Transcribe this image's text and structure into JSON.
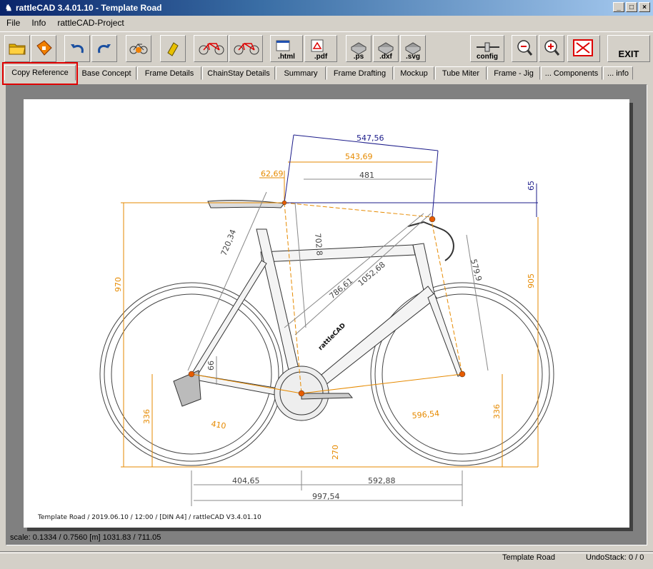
{
  "window": {
    "title": "rattleCAD  3.4.01.10 - Template Road",
    "buttons": {
      "minimize": "_",
      "maximize": "□",
      "close": "×"
    }
  },
  "menu": {
    "items": [
      {
        "label": "File"
      },
      {
        "label": "Info"
      },
      {
        "label": "rattleCAD-Project"
      }
    ]
  },
  "toolbar": {
    "buttons": [
      {
        "name": "open-folder",
        "label": "",
        "icon": "folder-icon"
      },
      {
        "name": "save",
        "label": "",
        "icon": "save-icon"
      },
      {
        "name": "undo",
        "label": "",
        "icon": "undo-icon"
      },
      {
        "name": "redo",
        "label": "",
        "icon": "redo-icon"
      },
      {
        "name": "render-bike",
        "label": "",
        "icon": "bike-render-icon"
      },
      {
        "name": "eraser",
        "label": "",
        "icon": "eraser-icon"
      },
      {
        "name": "bike-template-a",
        "label": "",
        "icon": "bike-template-icon"
      },
      {
        "name": "bike-template-b",
        "label": "",
        "icon": "bike-template-icon"
      },
      {
        "name": "export-html",
        "label": ".html",
        "icon": "html-export-icon"
      },
      {
        "name": "export-pdf",
        "label": ".pdf",
        "icon": "pdf-export-icon"
      },
      {
        "name": "export-ps",
        "label": ".ps",
        "icon": "ps-export-icon"
      },
      {
        "name": "export-dxf",
        "label": ".dxf",
        "icon": "dxf-export-icon"
      },
      {
        "name": "export-svg",
        "label": ".svg",
        "icon": "svg-export-icon"
      },
      {
        "name": "config",
        "label": "config",
        "icon": "config-icon"
      },
      {
        "name": "zoom-out",
        "label": "",
        "icon": "zoom-out-icon"
      },
      {
        "name": "zoom-in",
        "label": "",
        "icon": "zoom-in-icon"
      },
      {
        "name": "fit",
        "label": "",
        "icon": "fit-screen-icon"
      },
      {
        "name": "exit",
        "label": "EXIT",
        "icon": ""
      }
    ]
  },
  "tabs": [
    {
      "label": "Copy Reference",
      "active": true
    },
    {
      "label": "Base Concept"
    },
    {
      "label": "Frame Details"
    },
    {
      "label": "ChainStay Details"
    },
    {
      "label": "Summary"
    },
    {
      "label": "Frame Drafting"
    },
    {
      "label": "Mockup"
    },
    {
      "label": "Tube Miter"
    },
    {
      "label": "Frame - Jig"
    },
    {
      "label": "... Components"
    },
    {
      "label": "... info"
    }
  ],
  "drawing": {
    "dims": {
      "top_blue": "547,56",
      "top_orange": "543,69",
      "setback": "62,69",
      "reach": "481",
      "drop": "65",
      "seat_height": "970",
      "stack": "905",
      "seat_len": "720,34",
      "st_len": "702,8",
      "diag1": "786,61",
      "diag2": "1052,68",
      "fork": "579,9",
      "bb_drop": "66",
      "left_h": "336",
      "right_h": "336",
      "cs": "410",
      "front_c": "596,54",
      "bb_height": "270",
      "rear_center": "404,65",
      "front_center": "592,88",
      "wheelbase": "997,54"
    },
    "footer": "Template Road  /  2019.06.10 / 12:00  /  [DIN A4]  /  rattleCAD  V3.4.01.10",
    "brand": "rattleCAD"
  },
  "status": {
    "scale": "scale: 0.1334 / 0.7560  [m]  1031.83 / 711.05",
    "project": "Template Road",
    "undo_label": "UndoStack:",
    "undo_value": "0 / 0"
  },
  "colors": {
    "accent_orange": "#e68a00",
    "dim_blue": "#1c1c8a",
    "highlight_red": "#e00000",
    "title_blue": "#0a246a"
  }
}
